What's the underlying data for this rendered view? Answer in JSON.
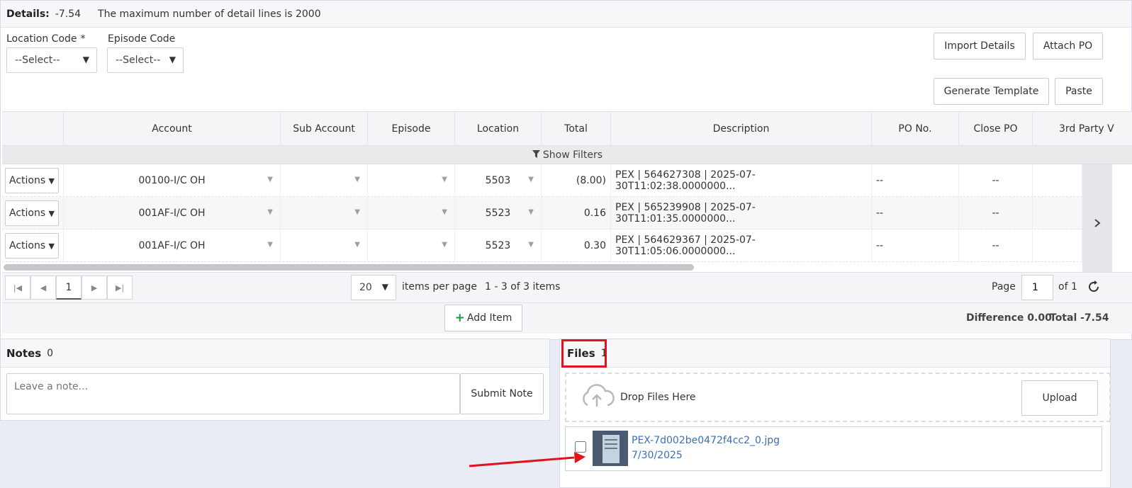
{
  "details": {
    "label": "Details:",
    "amount": "-7.54",
    "max_lines_msg": "The maximum number of detail lines is 2000"
  },
  "filters": {
    "location_label": "Location Code",
    "location_required": "*",
    "location_value": "--Select--",
    "episode_label": "Episode Code",
    "episode_value": "--Select--"
  },
  "toolbar": {
    "import_details": "Import Details",
    "attach_po": "Attach PO",
    "generate_template": "Generate Template",
    "paste": "Paste"
  },
  "grid": {
    "columns": [
      "",
      "Account",
      "Sub Account",
      "Episode",
      "Location",
      "Total",
      "Description",
      "PO No.",
      "Close PO",
      "3rd Party V"
    ],
    "show_filters": "Show Filters",
    "rows": [
      {
        "actions": "Actions",
        "account": "00100-I/C OH",
        "location": "5503",
        "total": "(8.00)",
        "description": "PEX | 564627308 | 2025-07-30T11:02:38.0000000...",
        "po_no": "--",
        "close_po": "--"
      },
      {
        "actions": "Actions",
        "account": "001AF-I/C OH",
        "location": "5523",
        "total": "0.16",
        "description": "PEX | 565239908 | 2025-07-30T11:01:35.0000000...",
        "po_no": "--",
        "close_po": "--"
      },
      {
        "actions": "Actions",
        "account": "001AF-I/C OH",
        "location": "5523",
        "total": "0.30",
        "description": "PEX | 564629367 | 2025-07-30T11:05:06.0000000...",
        "po_no": "--",
        "close_po": "--"
      }
    ],
    "pager": {
      "current_page": "1",
      "page_size": "20",
      "items_per_page": "items per page",
      "range": "1 - 3 of 3 items",
      "page_label": "Page",
      "page_input": "1",
      "of_label": "of 1"
    },
    "add_item": "Add Item",
    "difference": "Difference 0.00",
    "total": "Total -7.54"
  },
  "notes": {
    "title": "Notes",
    "count": "0",
    "placeholder": "Leave a note...",
    "submit": "Submit Note"
  },
  "files": {
    "title": "Files",
    "count": "1",
    "drop_text": "Drop Files Here",
    "upload": "Upload",
    "items": [
      {
        "name": "PEX-7d002be0472f4cc2_0.jpg",
        "date": "7/30/2025"
      }
    ]
  },
  "colors": {
    "highlight_red": "#e0141c",
    "link_blue": "#3b6fb5",
    "add_green": "#1a9a3c"
  }
}
